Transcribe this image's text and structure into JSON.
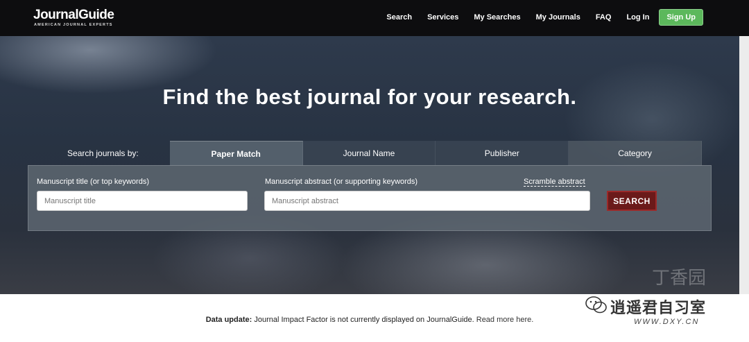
{
  "header": {
    "logo_main": "JournalGuide",
    "logo_sub": "AMERICAN JOURNAL EXPERTS",
    "nav": [
      "Search",
      "Services",
      "My Searches",
      "My Journals",
      "FAQ",
      "Log In"
    ],
    "signup_label": "Sign Up"
  },
  "hero": {
    "headline": "Find the best journal for your research."
  },
  "search": {
    "by_label": "Search journals by:",
    "tabs": [
      "Paper Match",
      "Journal Name",
      "Publisher",
      "Category"
    ],
    "title_label": "Manuscript title (or top keywords)",
    "title_placeholder": "Manuscript title",
    "abstract_label": "Manuscript abstract (or supporting keywords)",
    "abstract_placeholder": "Manuscript abstract",
    "scramble_label": "Scramble abstract",
    "button_label": "SEARCH"
  },
  "footer": {
    "update_bold": "Data update:",
    "update_text": " Journal Impact Factor is not currently displayed on JournalGuide. ",
    "read_more": "Read more here."
  },
  "watermark": {
    "text": "逍遥君自习室",
    "url": "WWW.DXY.CN",
    "bg_text": "丁香园"
  },
  "colors": {
    "topbar": "#0d0d0f",
    "signup": "#5cb85c",
    "search_button": "#6b1a1a"
  }
}
